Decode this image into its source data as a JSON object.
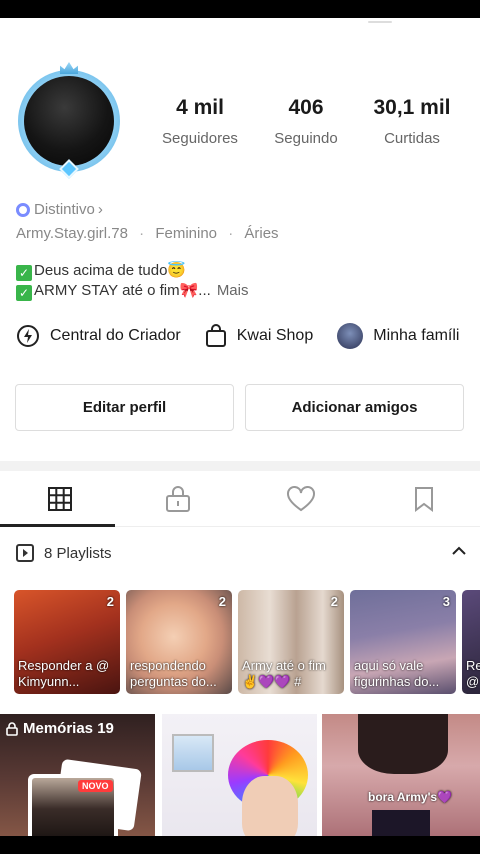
{
  "stats": [
    {
      "value": "4 mil",
      "label": "Seguidores"
    },
    {
      "value": "406",
      "label": "Seguindo"
    },
    {
      "value": "30,1 mil",
      "label": "Curtidas"
    }
  ],
  "badge": {
    "label": "Distintivo",
    "chevron": "›"
  },
  "info": {
    "handle": "Army.Stay.girl.78",
    "gender": "Feminino",
    "sign": "Áries",
    "separator": "·"
  },
  "bio": {
    "line1": "Deus acima de tudo",
    "line1_emoji": "😇",
    "line2": "ARMY STAY até o fim",
    "line2_emoji": "🎀",
    "ellipsis": "...",
    "more": "Mais"
  },
  "links": [
    {
      "label": "Central do Criador",
      "icon": "lightning-icon"
    },
    {
      "label": "Kwai Shop",
      "icon": "shopping-bag-icon"
    },
    {
      "label": "Minha famíli",
      "icon": "family-avatar"
    }
  ],
  "buttons": {
    "edit": "Editar perfil",
    "add": "Adicionar amigos"
  },
  "tabs": [
    "grid-icon",
    "lock-icon",
    "heart-icon",
    "bookmark-icon"
  ],
  "playlists": {
    "title": "8 Playlists",
    "items": [
      {
        "count": "2",
        "caption": "Responder a @ Kimyunn..."
      },
      {
        "count": "2",
        "caption": "respondendo perguntas do..."
      },
      {
        "count": "2",
        "caption": "Army até o fim ✌💜💜 #"
      },
      {
        "count": "3",
        "caption": "aqui só vale figurinhas do..."
      },
      {
        "count": "",
        "caption": "Re @"
      }
    ]
  },
  "tiles": {
    "memories": {
      "label": "Memórias 19",
      "new_badge": "NOVO"
    },
    "video3_caption": "bora Army's💜"
  },
  "colors": {
    "accent": "#222222",
    "badge": "#7a8cff",
    "check": "#39b54a",
    "novo": "#ff3b3b"
  }
}
